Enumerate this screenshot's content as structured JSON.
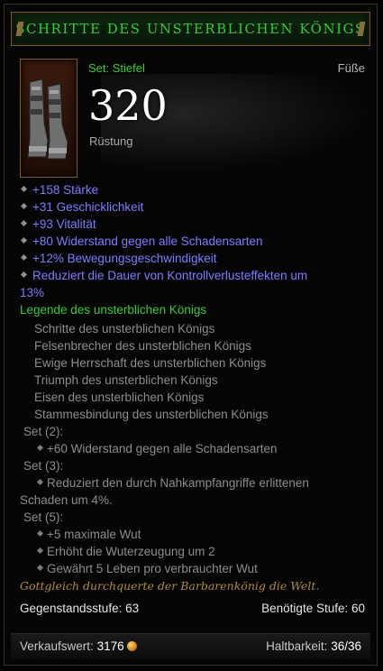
{
  "item": {
    "name": "SCHRITTE DES UNSTERBLICHEN KÖNIGS",
    "set_label": "Set: Stiefel",
    "slot": "Füße",
    "armor_value": "320",
    "armor_label": "Rüstung"
  },
  "stats": [
    "+158 Stärke",
    "+31 Geschicklichkeit",
    "+93 Vitalität",
    "+80 Widerstand gegen alle Schadensarten",
    "+12% Bewegungsgeschwindigkeit"
  ],
  "stat_wrap": {
    "line1": "Reduziert die Dauer von Kontrollverlusteffekten um",
    "line2": "13%"
  },
  "set": {
    "name": "Legende des unsterblichen Königs",
    "items": [
      "Schritte des unsterblichen Königs",
      "Felsenbrecher des unsterblichen Königs",
      "Ewige Herrschaft des unsterblichen Königs",
      "Triumph des unsterblichen Königs",
      "Eisen des unsterblichen Königs",
      "Stammesbindung des unsterblichen Königs"
    ],
    "bonus2": {
      "label": "Set (2):",
      "line": "+60 Widerstand gegen alle Schadensarten"
    },
    "bonus3": {
      "label": "Set (3):",
      "line1": "Reduziert den durch Nahkampfangriffe erlittenen",
      "line2": "Schaden um 4%."
    },
    "bonus5": {
      "label": "Set (5):",
      "lines": [
        "+5 maximale Wut",
        "Erhöht die Wuterzeugung um 2",
        "Gewährt 5 Leben pro verbrauchter Wut"
      ]
    }
  },
  "flavor": "Gottgleich durchquerte der Barbarenkönig die Welt.",
  "levels": {
    "item_level": "Gegenstandsstufe: 63",
    "required_level": "Benötigte Stufe: 60"
  },
  "footer": {
    "sell_label": "Verkaufswert:",
    "sell_value": "3176",
    "durability_label": "Haltbarkeit:",
    "durability_value": "36/36"
  },
  "colors": {
    "set_green": "#33cc33",
    "magic_blue": "#7b7bff",
    "flavor_gold": "#b08a3a",
    "grey_text": "#8c8c8c"
  },
  "icons": [
    "boots-icon",
    "gem-socket-bullet-icon",
    "gold-coin-icon"
  ]
}
